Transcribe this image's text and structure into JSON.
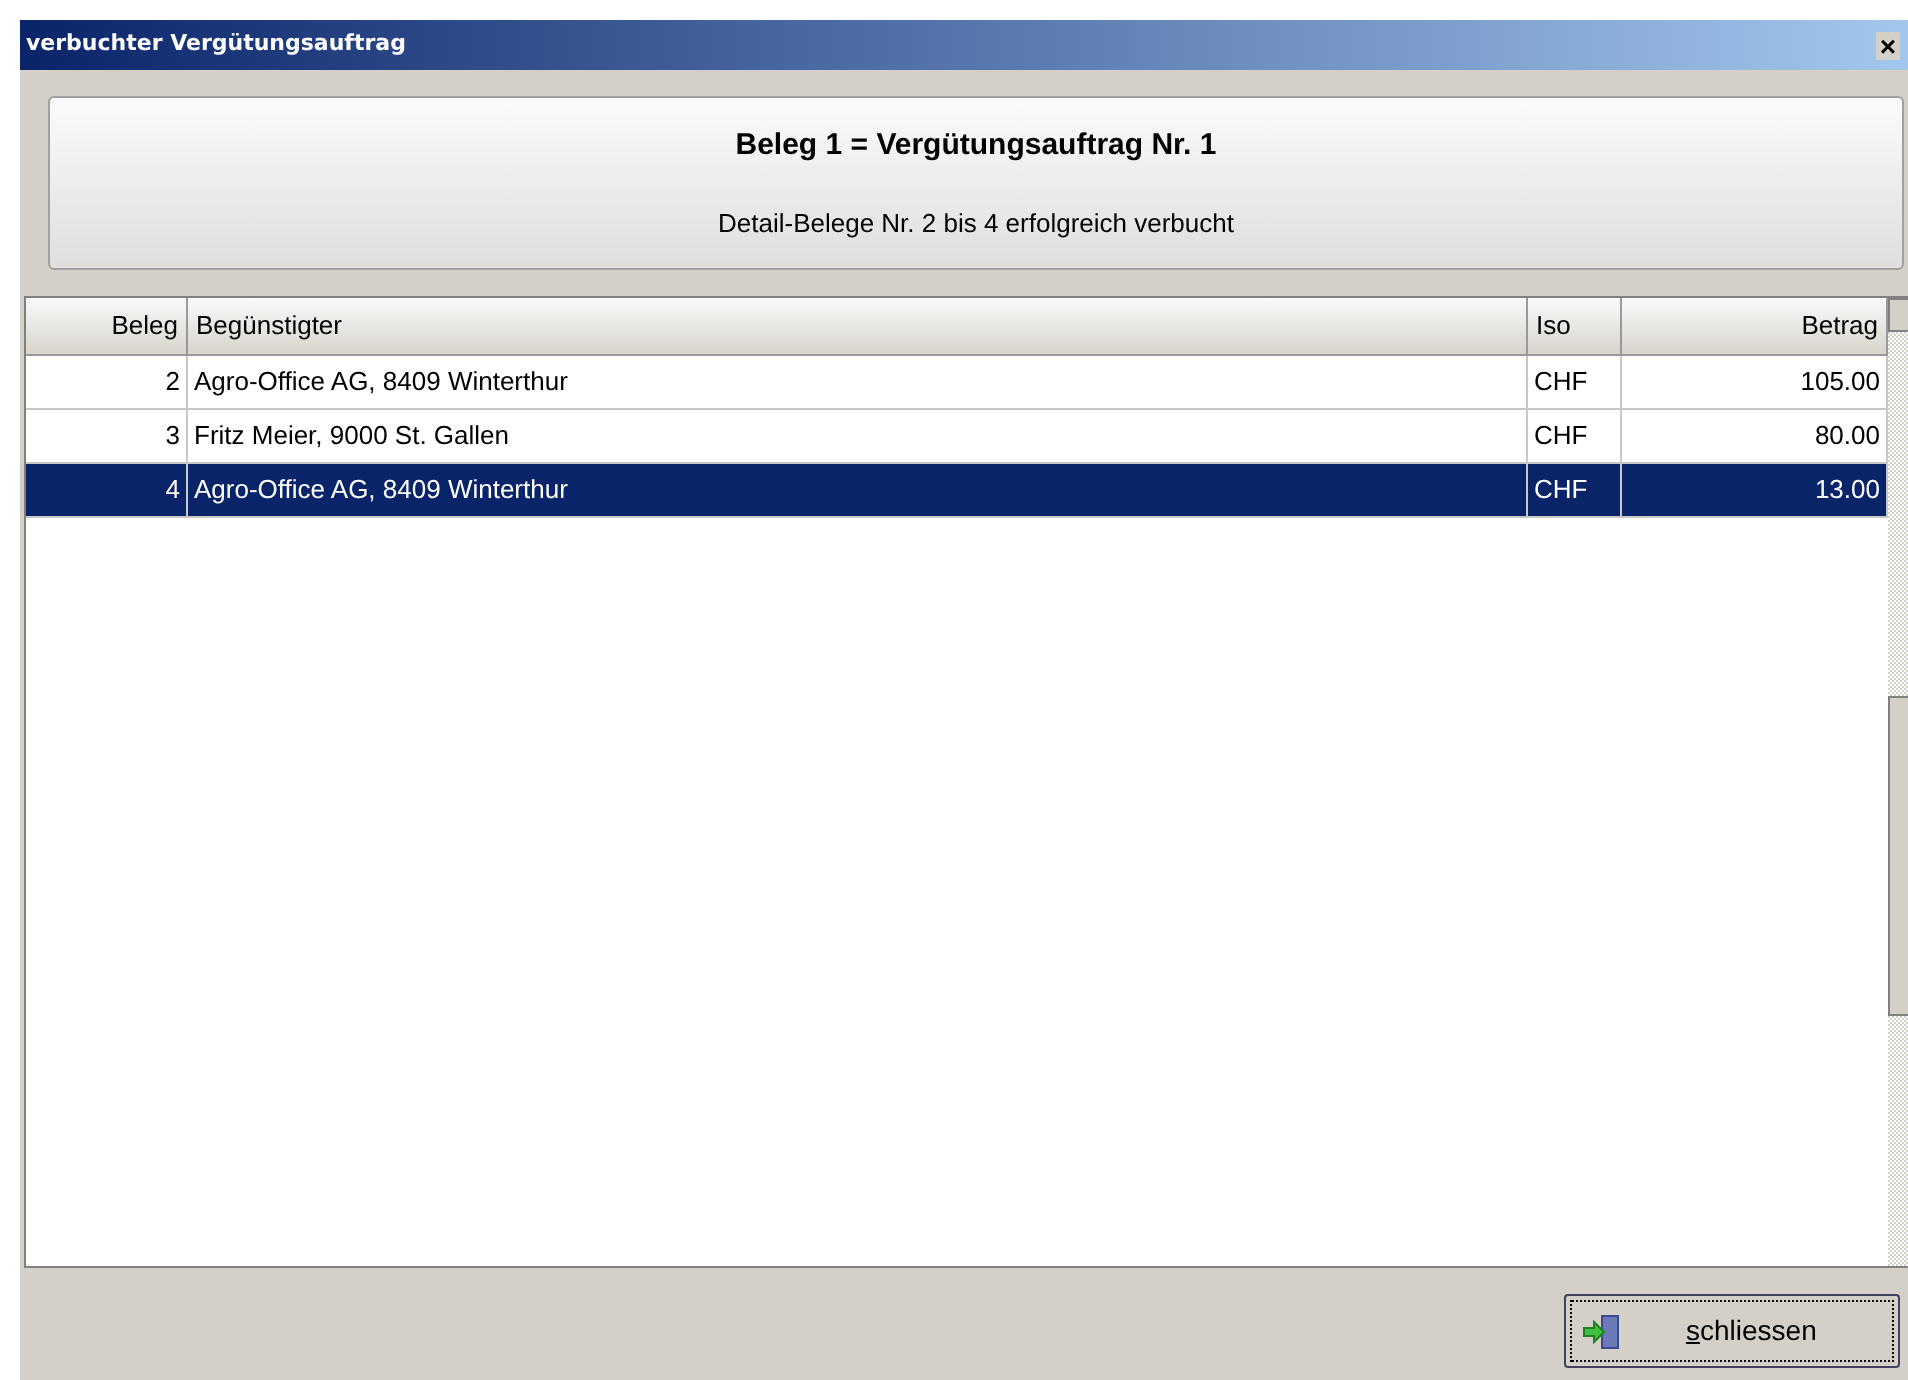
{
  "window": {
    "title": "verbuchter Vergütungsauftrag",
    "close": "×"
  },
  "header": {
    "title": "Beleg 1 = Vergütungsauftrag Nr. 1",
    "subtitle": "Detail-Belege Nr. 2 bis 4 erfolgreich verbucht"
  },
  "table": {
    "columns": [
      "Beleg",
      "Begünstigter",
      "Iso",
      "Betrag"
    ],
    "rows": [
      {
        "beleg": "2",
        "beguenstigter": "Agro-Office AG, 8409 Winterthur",
        "iso": "CHF",
        "betrag": "105.00",
        "selected": false
      },
      {
        "beleg": "3",
        "beguenstigter": "Fritz Meier, 9000 St. Gallen",
        "iso": "CHF",
        "betrag": "80.00",
        "selected": false
      },
      {
        "beleg": "4",
        "beguenstigter": "Agro-Office AG, 8409 Winterthur",
        "iso": "CHF",
        "betrag": "13.00",
        "selected": true
      }
    ]
  },
  "buttons": [
    {
      "label": "schliessen"
    }
  ]
}
